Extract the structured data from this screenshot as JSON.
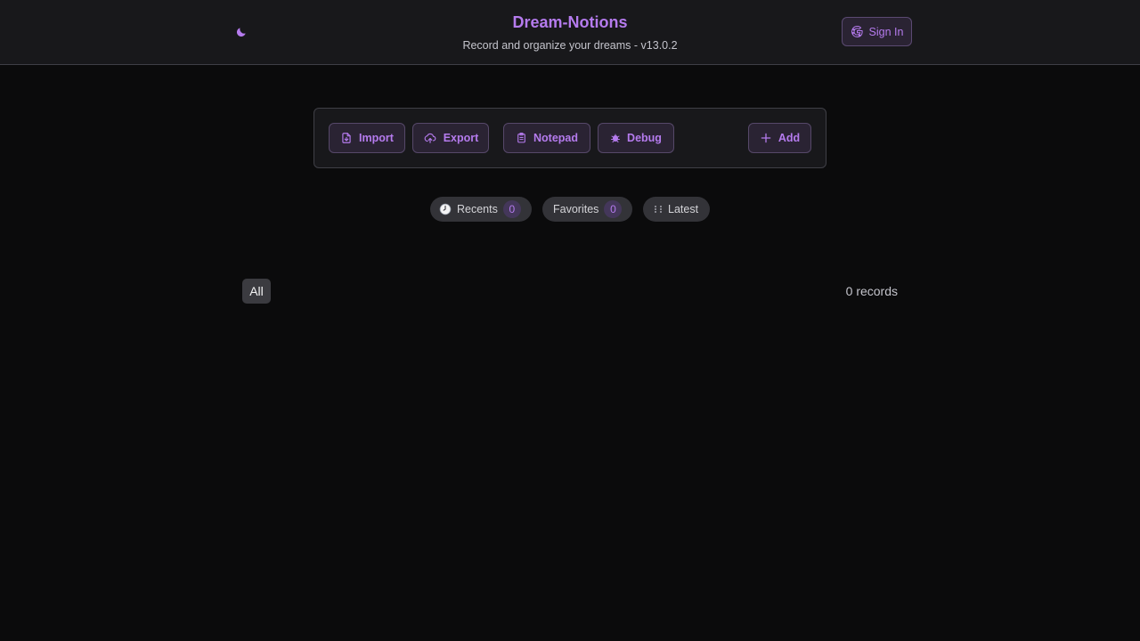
{
  "header": {
    "title": "Dream-Notions",
    "subtitle": "Record and organize your dreams - v13.0.2",
    "theme_icon": "moon-icon",
    "signin_label": "Sign In",
    "signin_icon": "google-icon"
  },
  "toolbar": {
    "import_label": "Import",
    "export_label": "Export",
    "notepad_label": "Notepad",
    "debug_label": "Debug",
    "add_label": "Add",
    "icons": {
      "import": "file-import-icon",
      "export": "cloud-upload-icon",
      "notepad": "clipboard-icon",
      "debug": "bug-icon",
      "add": "plus-icon"
    }
  },
  "filters": {
    "recents_label": "Recents",
    "recents_count": "0",
    "recents_icon": "clock-icon",
    "favorites_label": "Favorites",
    "favorites_count": "0",
    "latest_label": "Latest",
    "latest_icon": "grid-dots-icon"
  },
  "list": {
    "category_all": "All",
    "records_text": "0 records"
  },
  "colors": {
    "accent": "#b57bee",
    "background": "#0b0b0c",
    "surface": "#18181b",
    "border": "#3f3f46"
  }
}
